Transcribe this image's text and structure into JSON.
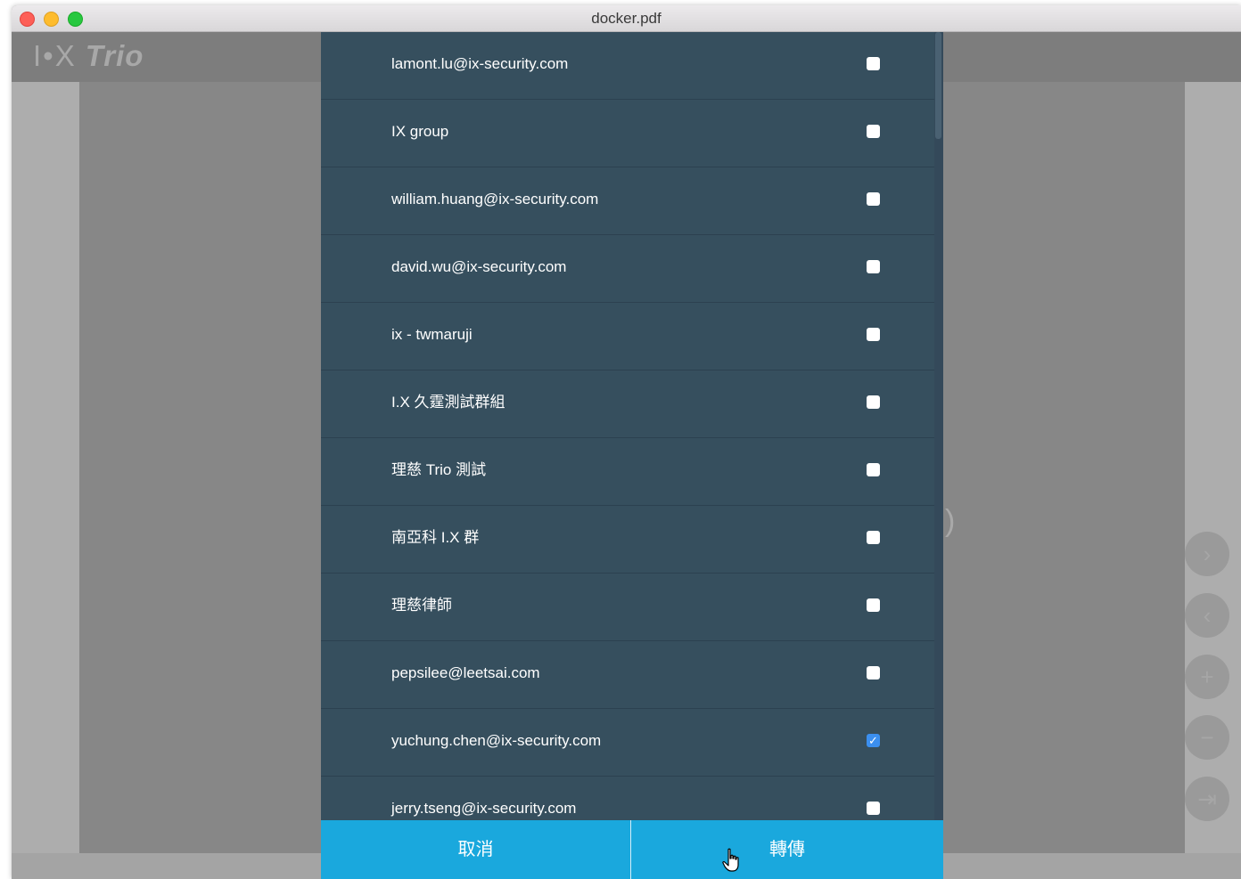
{
  "window": {
    "title": "docker.pdf"
  },
  "app": {
    "logo_mark": "I•X",
    "logo_text": "Trio"
  },
  "background": {
    "paren_text": ")"
  },
  "side_controls": [
    {
      "icon": "chevron-right-icon",
      "glyph": "›"
    },
    {
      "icon": "chevron-left-icon",
      "glyph": "‹"
    },
    {
      "icon": "zoom-in-icon",
      "glyph": "+"
    },
    {
      "icon": "zoom-out-icon",
      "glyph": "−"
    },
    {
      "icon": "exit-icon",
      "glyph": "⇥"
    }
  ],
  "dialog": {
    "recipients": [
      {
        "label": "lamont.lu@ix-security.com",
        "checked": false
      },
      {
        "label": "IX group",
        "checked": false
      },
      {
        "label": "william.huang@ix-security.com",
        "checked": false
      },
      {
        "label": "david.wu@ix-security.com",
        "checked": false
      },
      {
        "label": "ix - twmaruji",
        "checked": false
      },
      {
        "label": "I.X 久霆測試群組",
        "checked": false
      },
      {
        "label": "理慈 Trio 測試",
        "checked": false
      },
      {
        "label": "南亞科 I.X 群",
        "checked": false
      },
      {
        "label": "理慈律師",
        "checked": false
      },
      {
        "label": "pepsilee@leetsai.com",
        "checked": false
      },
      {
        "label": "yuchung.chen@ix-security.com",
        "checked": true
      },
      {
        "label": "jerry.tseng@ix-security.com",
        "checked": false
      }
    ],
    "cancel_label": "取消",
    "forward_label": "轉傳"
  },
  "colors": {
    "dialog_bg": "#364f5e",
    "button": "#1aa8dd",
    "checkbox_checked": "#3b8fef"
  }
}
